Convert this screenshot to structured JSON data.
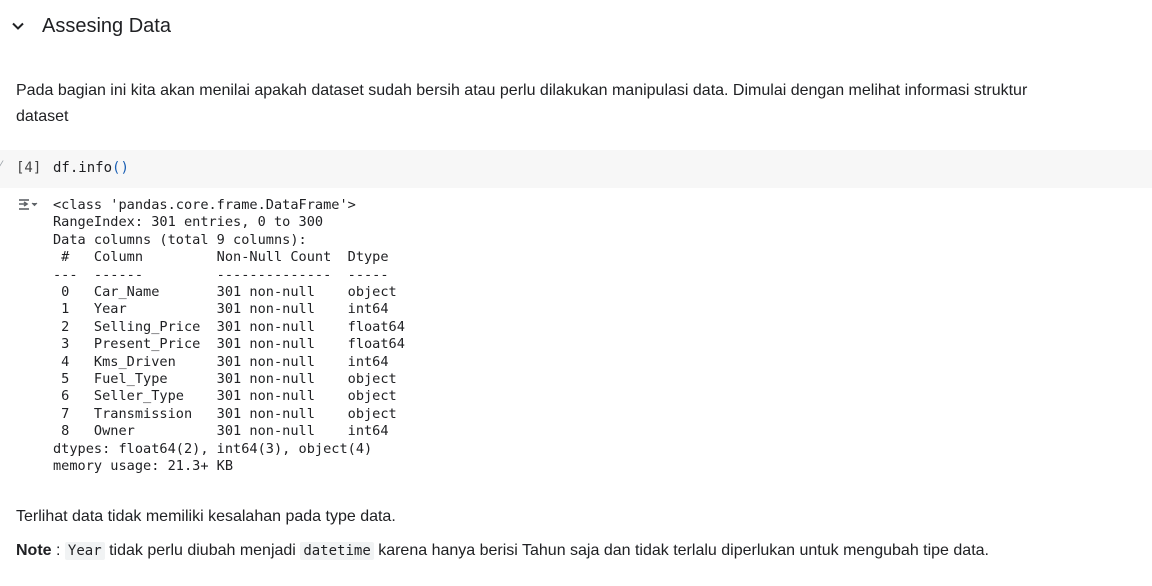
{
  "section": {
    "title": "Assesing Data",
    "chevron_icon": "chevron-down-icon"
  },
  "markdown_intro": "Pada bagian ini kita akan menilai apakah dataset sudah bersih atau perlu dilakukan manipulasi data. Dimulai dengan melihat informasi struktur dataset",
  "code_cell": {
    "execution_count": "[4]",
    "code_prefix": "df.info",
    "code_parens": "()"
  },
  "output": {
    "icon": "output-collapse-icon",
    "text": "<class 'pandas.core.frame.DataFrame'>\nRangeIndex: 301 entries, 0 to 300\nData columns (total 9 columns):\n #   Column         Non-Null Count  Dtype  \n---  ------         --------------  -----  \n 0   Car_Name       301 non-null    object \n 1   Year           301 non-null    int64  \n 2   Selling_Price  301 non-null    float64\n 3   Present_Price  301 non-null    float64\n 4   Kms_Driven     301 non-null    int64  \n 5   Fuel_Type      301 non-null    object \n 6   Seller_Type    301 non-null    object \n 7   Transmission   301 non-null    object \n 8   Owner          301 non-null    int64  \ndtypes: float64(2), int64(3), object(4)\nmemory usage: 21.3+ KB"
  },
  "markdown_after": {
    "line1": "Terlihat data tidak memiliki kesalahan pada type data.",
    "note_label": "Note",
    "note_colon": " : ",
    "code1": "Year",
    "text_mid": " tidak perlu diubah menjadi ",
    "code2": "datetime",
    "text_end": " karena hanya berisi Tahun saja dan tidak terlalu diperlukan untuk mengubah tipe data."
  }
}
